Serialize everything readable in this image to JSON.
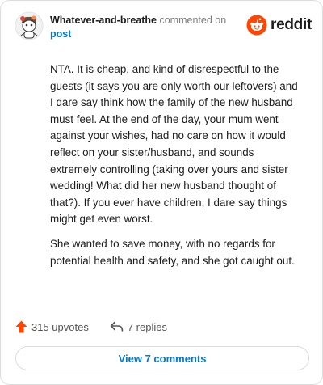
{
  "comment": {
    "username": "Whatever-and-breathe",
    "action_text": "commented on",
    "post_link": "post",
    "brand": "reddit",
    "paragraphs": [
      "NTA. It is cheap, and kind of disrespectful to the guests (it says you are only worth our leftovers) and I dare say think how the family of the new husband must feel. At the end of the day, your mum went against your wishes, had no care on how it would reflect on your sister/husband, and sounds extremely controlling (taking over yours and sister wedding! What did her new husband thought of that?). If you ever have children, I dare say things might get even worst.",
      "She wanted to save money, with no regards for potential health and safety, and she got caught out."
    ]
  },
  "footer": {
    "upvotes": "315 upvotes",
    "replies": "7 replies",
    "view_button": "View 7 comments"
  },
  "colors": {
    "accent": "#0079d3",
    "reddit_orange": "#ff4500"
  }
}
